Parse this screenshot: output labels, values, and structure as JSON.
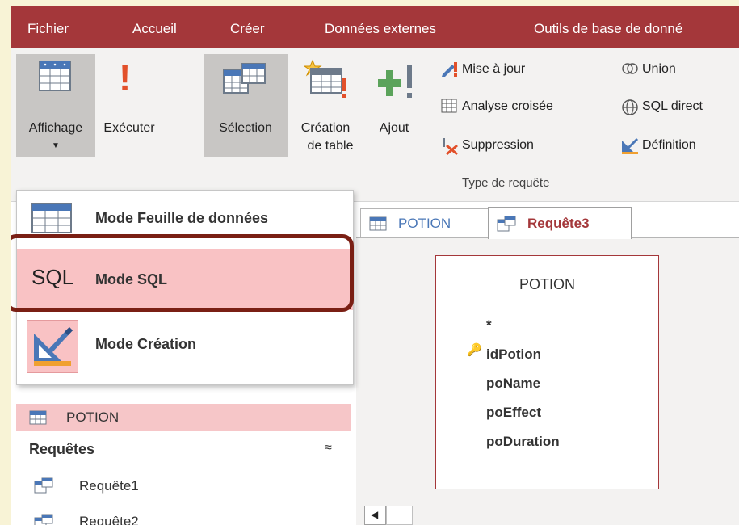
{
  "ribbon_tabs": [
    "Fichier",
    "Accueil",
    "Créer",
    "Données externes",
    "Outils de base de donné"
  ],
  "ribbon": {
    "affichage": "Affichage",
    "executer": "Exécuter",
    "selection": "Sélection",
    "creation_table_1": "Création",
    "creation_table_2": "de table",
    "ajout": "Ajout",
    "mise_a_jour": "Mise à jour",
    "analyse_croisee": "Analyse croisée",
    "suppression": "Suppression",
    "union": "Union",
    "sql_direct": "SQL direct",
    "definition": "Définition",
    "group_label": "Type de requête"
  },
  "dropdown": {
    "items": [
      {
        "label": "Mode Feuille de données",
        "icon": "datasheet-icon"
      },
      {
        "label": "Mode SQL",
        "icon_text": "SQL",
        "highlighted": true
      },
      {
        "label": "Mode Création",
        "icon": "design-ruler-icon"
      }
    ]
  },
  "nav": {
    "table_item": "POTION",
    "queries_header": "Requêtes",
    "collapse_glyph": "≈",
    "queries": [
      "Requête1",
      "Requête2"
    ]
  },
  "doc_tabs": [
    {
      "label": "POTION",
      "icon": "table-icon",
      "active": false
    },
    {
      "label": "Requête3",
      "icon": "query-icon",
      "active": true
    }
  ],
  "design": {
    "table_name": "POTION",
    "fields": [
      "*",
      "idPotion",
      "poName",
      "poEffect",
      "poDuration"
    ],
    "primary_key_field": "idPotion"
  },
  "colors": {
    "accent": "#a4373a",
    "highlight": "#f9c2c4",
    "frame": "#7a1f14"
  }
}
